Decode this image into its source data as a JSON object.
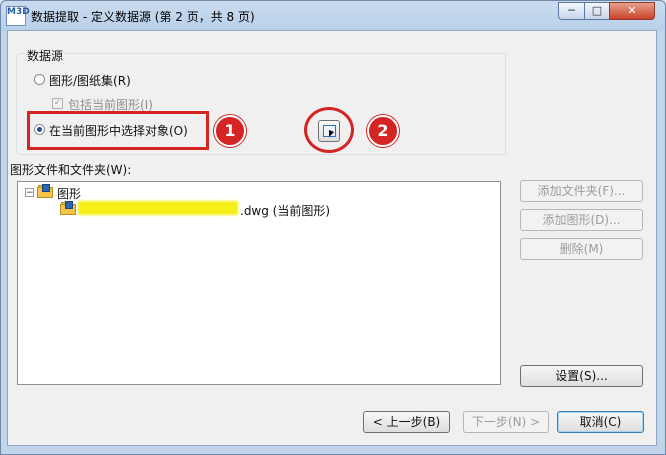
{
  "window": {
    "app_icon_text": "M3D",
    "title": "数据提取 - 定义数据源 (第 2 页，共 8 页)",
    "controls": {
      "minimize": "─",
      "maximize": "□",
      "close": "✕"
    }
  },
  "data_source": {
    "group_label": "数据源",
    "radio_drawings": "图形/图纸集(R)",
    "check_include_current": "包括当前图形(I)",
    "radio_select_objects": "在当前图形中选择对象(O)",
    "selected": "select_objects"
  },
  "annotations": {
    "badge1": "1",
    "badge2": "2",
    "accent": "#d42424"
  },
  "files": {
    "label": "图形文件和文件夹(W):",
    "root_label": "图形",
    "child_suffix": ".dwg (当前图形)"
  },
  "side_buttons": {
    "add_folder": "添加文件夹(F)...",
    "add_drawing": "添加图形(D)...",
    "delete": "删除(M)",
    "settings": "设置(S)..."
  },
  "footer": {
    "back": "< 上一步(B)",
    "next": "下一步(N) >",
    "cancel": "取消(C)"
  }
}
